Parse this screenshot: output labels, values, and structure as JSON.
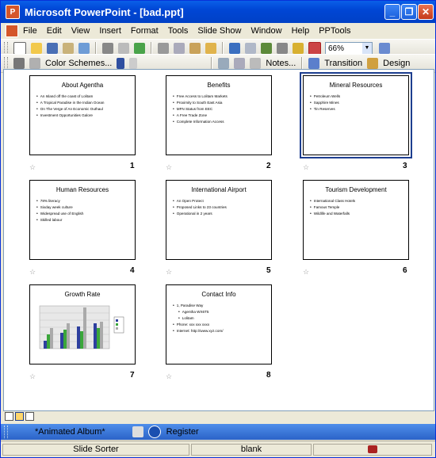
{
  "window": {
    "title": "Microsoft PowerPoint - [bad.ppt]",
    "app_icon_glyph": "P"
  },
  "titlebar_buttons": [
    "_",
    "❒",
    "✕"
  ],
  "menus": [
    "File",
    "Edit",
    "View",
    "Insert",
    "Format",
    "Tools",
    "Slide Show",
    "Window",
    "Help",
    "PPTools"
  ],
  "standard_toolbar": {
    "zoom": "66%"
  },
  "sorter_toolbar": {
    "color_schemes": "Color Schemes...",
    "notes": "Notes...",
    "transition": "Transition",
    "design": "Design"
  },
  "slides": [
    {
      "num": "1",
      "title": "About Agentha",
      "bullets": [
        "An Island off the coast of Lolitam",
        "A Tropical Paradise in the Indian Ocean",
        "On The Verge of An Economic Outhaul",
        "Investment Opportunities Galore"
      ]
    },
    {
      "num": "2",
      "title": "Benefits",
      "bullets": [
        "Free Access to Lolitam Markets",
        "Proximity to South East Asia",
        "MFN Status from EEC",
        "A Free Trade Zone",
        "Complete Information Access"
      ]
    },
    {
      "num": "3",
      "title": "Mineral Resources",
      "bullets": [
        "Petroleum Wells",
        "Sapphire Mines",
        "Tin Reserves"
      ]
    },
    {
      "num": "4",
      "title": "Human Resources",
      "bullets": [
        "78% literacy",
        "Sixday week culture",
        "Widespread use of English",
        "Skilled labour"
      ]
    },
    {
      "num": "5",
      "title": "International Airport",
      "bullets": [
        "An Open Protect",
        "Proposed Links to 23 countries",
        "Operational in 2 years"
      ]
    },
    {
      "num": "6",
      "title": "Tourism Development",
      "bullets": [
        "International Class Hotels",
        "Famous Temple",
        "Wildlife and Waterfalls"
      ]
    },
    {
      "num": "7",
      "title": "Growth Rate",
      "bullets": []
    },
    {
      "num": "8",
      "title": "Contact Info",
      "bullets": [
        "1, Paradise Way",
        "Agentha WX6T5",
        "Lolitam",
        "Phone: xxx xxx xxxx",
        "Internet: http://www.xyz.com/"
      ]
    }
  ],
  "bottom_toolbar": {
    "album": "*Animated Album*",
    "register": "Register"
  },
  "status": {
    "view": "Slide Sorter",
    "design": "blank"
  },
  "colors": {
    "title_blue": "#0a5fe8",
    "selected_border": "#1d3e8f"
  }
}
